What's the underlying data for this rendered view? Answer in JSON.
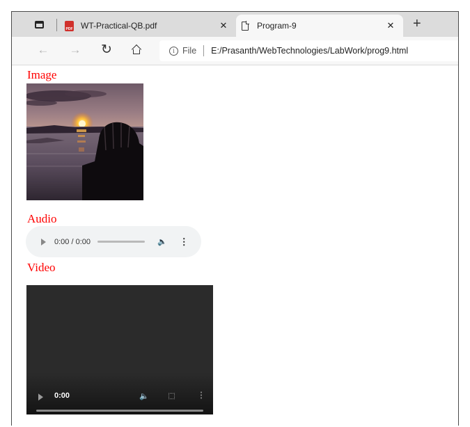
{
  "browser": {
    "tabs": [
      {
        "title": "WT-Practical-QB.pdf",
        "icon": "pdf-icon",
        "active": false
      },
      {
        "title": "Program-9",
        "icon": "document-icon",
        "active": true
      }
    ],
    "new_tab_glyph": "+",
    "close_glyph": "✕",
    "address": {
      "scheme_label": "File",
      "url": "E:/Prasanth/WebTechnologies/LabWork/prog9.html"
    }
  },
  "page": {
    "image_heading": "Image",
    "audio_heading": "Audio",
    "video_heading": "Video",
    "audio_player": {
      "time": "0:00 / 0:00"
    },
    "video_player": {
      "time": "0:00"
    },
    "heading_color": "#ff0000"
  }
}
